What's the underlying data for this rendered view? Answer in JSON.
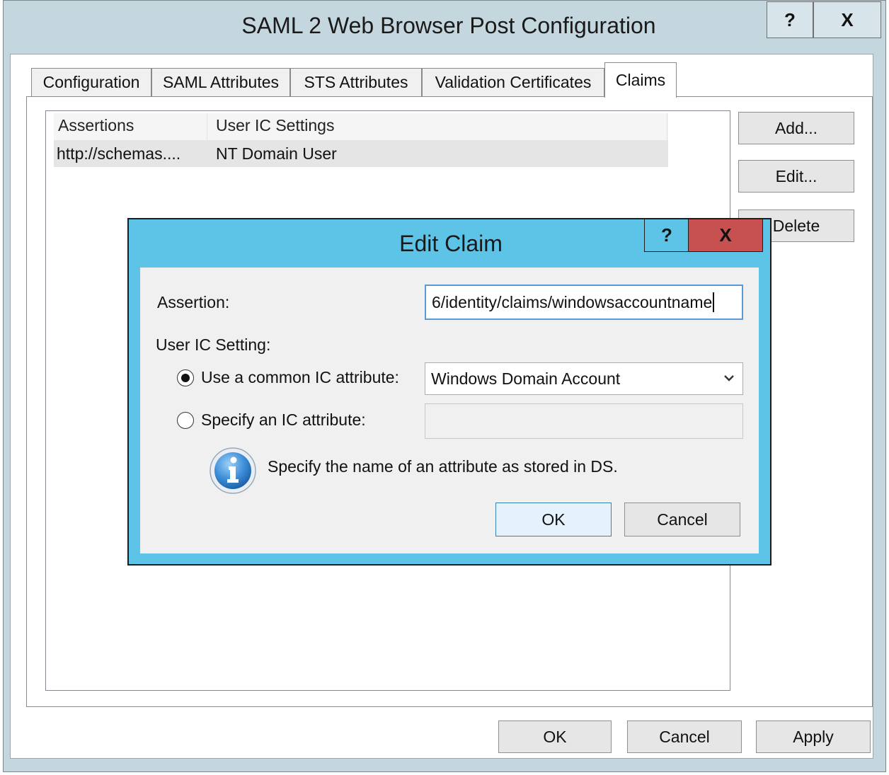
{
  "window": {
    "title": "SAML 2 Web Browser Post Configuration",
    "help_label": "?",
    "close_label": "X"
  },
  "tabs": [
    {
      "label": "Configuration"
    },
    {
      "label": "SAML Attributes"
    },
    {
      "label": "STS Attributes"
    },
    {
      "label": "Validation Certificates"
    },
    {
      "label": "Claims"
    }
  ],
  "active_tab": "Claims",
  "claims_list": {
    "columns": [
      "Assertions",
      "User IC Settings"
    ],
    "rows": [
      [
        "http://schemas....",
        "NT Domain User"
      ]
    ]
  },
  "side_buttons": {
    "add": "Add...",
    "edit": "Edit...",
    "delete": "Delete"
  },
  "footer": {
    "ok": "OK",
    "cancel": "Cancel",
    "apply": "Apply"
  },
  "dialog": {
    "title": "Edit Claim",
    "help_label": "?",
    "close_label": "X",
    "assertion_label": "Assertion:",
    "assertion_value": "6/identity/claims/windowsaccountname",
    "user_ic_label": "User IC Setting:",
    "radio_common_label": "Use a common IC attribute:",
    "radio_common_selected": true,
    "common_select_value": "Windows Domain Account",
    "radio_specify_label": "Specify an IC attribute:",
    "specify_value": "",
    "info_text": "Specify the name of an attribute as stored in DS.",
    "ok": "OK",
    "cancel": "Cancel"
  },
  "colors": {
    "dialog_frame": "#5ec4e7",
    "close_button": "#c75050",
    "window_frame": "#c4d6de"
  },
  "icons": [
    "info-icon",
    "chevron-down-icon"
  ]
}
